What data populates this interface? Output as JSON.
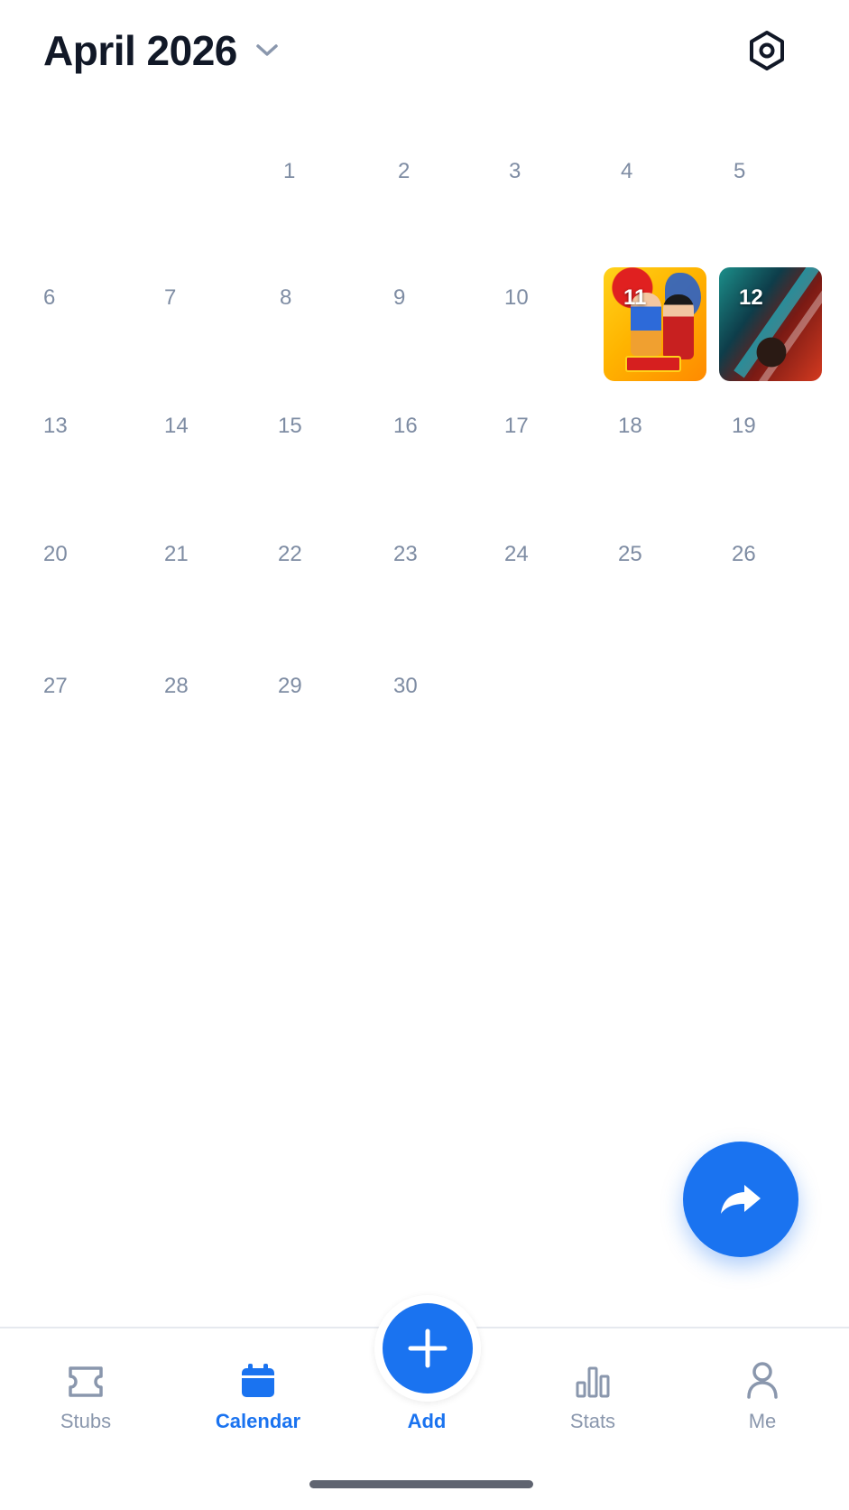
{
  "header": {
    "month_title": "April 2026",
    "chevron_icon": "chevron-down-icon",
    "settings_icon": "hexagon-settings-icon"
  },
  "calendar": {
    "week1": [
      "1",
      "2",
      "3",
      "4",
      "5"
    ],
    "week2": [
      "6",
      "7",
      "8",
      "9",
      "10"
    ],
    "week2_posters": [
      "11",
      "12"
    ],
    "week3": [
      "13",
      "14",
      "15",
      "16",
      "17",
      "18",
      "19"
    ],
    "week4": [
      "20",
      "21",
      "22",
      "23",
      "24",
      "25",
      "26"
    ],
    "week5": [
      "27",
      "28",
      "29",
      "30"
    ]
  },
  "fab": {
    "icon": "share-arrow-icon"
  },
  "nav": {
    "stubs": "Stubs",
    "calendar": "Calendar",
    "add": "Add",
    "stats": "Stats",
    "me": "Me"
  },
  "colors": {
    "accent": "#1a73f0",
    "muted": "#8a97ad",
    "day_text": "#7e8ca3",
    "title": "#111827"
  }
}
